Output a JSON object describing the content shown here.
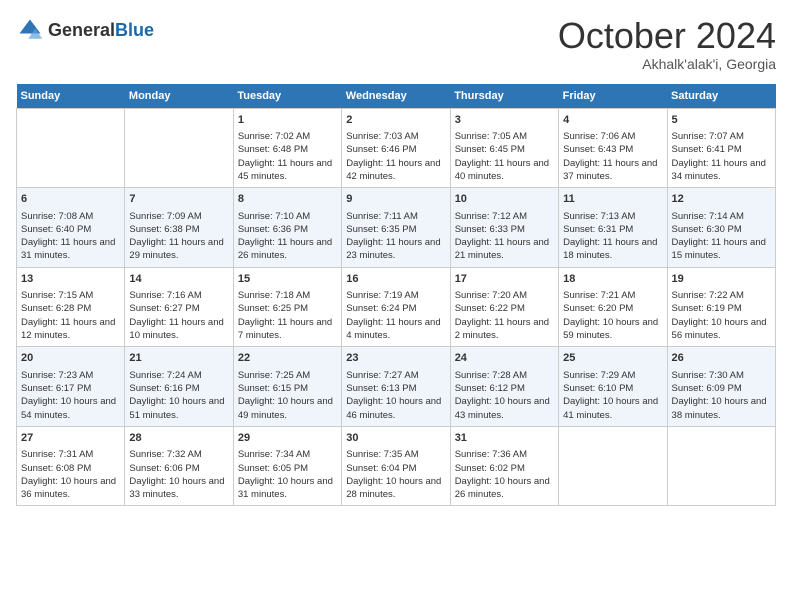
{
  "logo": {
    "general": "General",
    "blue": "Blue"
  },
  "header": {
    "month": "October 2024",
    "location": "Akhalk'alak'i, Georgia"
  },
  "columns": [
    "Sunday",
    "Monday",
    "Tuesday",
    "Wednesday",
    "Thursday",
    "Friday",
    "Saturday"
  ],
  "rows": [
    [
      {
        "day": "",
        "sunrise": "",
        "sunset": "",
        "daylight": ""
      },
      {
        "day": "",
        "sunrise": "",
        "sunset": "",
        "daylight": ""
      },
      {
        "day": "1",
        "sunrise": "Sunrise: 7:02 AM",
        "sunset": "Sunset: 6:48 PM",
        "daylight": "Daylight: 11 hours and 45 minutes."
      },
      {
        "day": "2",
        "sunrise": "Sunrise: 7:03 AM",
        "sunset": "Sunset: 6:46 PM",
        "daylight": "Daylight: 11 hours and 42 minutes."
      },
      {
        "day": "3",
        "sunrise": "Sunrise: 7:05 AM",
        "sunset": "Sunset: 6:45 PM",
        "daylight": "Daylight: 11 hours and 40 minutes."
      },
      {
        "day": "4",
        "sunrise": "Sunrise: 7:06 AM",
        "sunset": "Sunset: 6:43 PM",
        "daylight": "Daylight: 11 hours and 37 minutes."
      },
      {
        "day": "5",
        "sunrise": "Sunrise: 7:07 AM",
        "sunset": "Sunset: 6:41 PM",
        "daylight": "Daylight: 11 hours and 34 minutes."
      }
    ],
    [
      {
        "day": "6",
        "sunrise": "Sunrise: 7:08 AM",
        "sunset": "Sunset: 6:40 PM",
        "daylight": "Daylight: 11 hours and 31 minutes."
      },
      {
        "day": "7",
        "sunrise": "Sunrise: 7:09 AM",
        "sunset": "Sunset: 6:38 PM",
        "daylight": "Daylight: 11 hours and 29 minutes."
      },
      {
        "day": "8",
        "sunrise": "Sunrise: 7:10 AM",
        "sunset": "Sunset: 6:36 PM",
        "daylight": "Daylight: 11 hours and 26 minutes."
      },
      {
        "day": "9",
        "sunrise": "Sunrise: 7:11 AM",
        "sunset": "Sunset: 6:35 PM",
        "daylight": "Daylight: 11 hours and 23 minutes."
      },
      {
        "day": "10",
        "sunrise": "Sunrise: 7:12 AM",
        "sunset": "Sunset: 6:33 PM",
        "daylight": "Daylight: 11 hours and 21 minutes."
      },
      {
        "day": "11",
        "sunrise": "Sunrise: 7:13 AM",
        "sunset": "Sunset: 6:31 PM",
        "daylight": "Daylight: 11 hours and 18 minutes."
      },
      {
        "day": "12",
        "sunrise": "Sunrise: 7:14 AM",
        "sunset": "Sunset: 6:30 PM",
        "daylight": "Daylight: 11 hours and 15 minutes."
      }
    ],
    [
      {
        "day": "13",
        "sunrise": "Sunrise: 7:15 AM",
        "sunset": "Sunset: 6:28 PM",
        "daylight": "Daylight: 11 hours and 12 minutes."
      },
      {
        "day": "14",
        "sunrise": "Sunrise: 7:16 AM",
        "sunset": "Sunset: 6:27 PM",
        "daylight": "Daylight: 11 hours and 10 minutes."
      },
      {
        "day": "15",
        "sunrise": "Sunrise: 7:18 AM",
        "sunset": "Sunset: 6:25 PM",
        "daylight": "Daylight: 11 hours and 7 minutes."
      },
      {
        "day": "16",
        "sunrise": "Sunrise: 7:19 AM",
        "sunset": "Sunset: 6:24 PM",
        "daylight": "Daylight: 11 hours and 4 minutes."
      },
      {
        "day": "17",
        "sunrise": "Sunrise: 7:20 AM",
        "sunset": "Sunset: 6:22 PM",
        "daylight": "Daylight: 11 hours and 2 minutes."
      },
      {
        "day": "18",
        "sunrise": "Sunrise: 7:21 AM",
        "sunset": "Sunset: 6:20 PM",
        "daylight": "Daylight: 10 hours and 59 minutes."
      },
      {
        "day": "19",
        "sunrise": "Sunrise: 7:22 AM",
        "sunset": "Sunset: 6:19 PM",
        "daylight": "Daylight: 10 hours and 56 minutes."
      }
    ],
    [
      {
        "day": "20",
        "sunrise": "Sunrise: 7:23 AM",
        "sunset": "Sunset: 6:17 PM",
        "daylight": "Daylight: 10 hours and 54 minutes."
      },
      {
        "day": "21",
        "sunrise": "Sunrise: 7:24 AM",
        "sunset": "Sunset: 6:16 PM",
        "daylight": "Daylight: 10 hours and 51 minutes."
      },
      {
        "day": "22",
        "sunrise": "Sunrise: 7:25 AM",
        "sunset": "Sunset: 6:15 PM",
        "daylight": "Daylight: 10 hours and 49 minutes."
      },
      {
        "day": "23",
        "sunrise": "Sunrise: 7:27 AM",
        "sunset": "Sunset: 6:13 PM",
        "daylight": "Daylight: 10 hours and 46 minutes."
      },
      {
        "day": "24",
        "sunrise": "Sunrise: 7:28 AM",
        "sunset": "Sunset: 6:12 PM",
        "daylight": "Daylight: 10 hours and 43 minutes."
      },
      {
        "day": "25",
        "sunrise": "Sunrise: 7:29 AM",
        "sunset": "Sunset: 6:10 PM",
        "daylight": "Daylight: 10 hours and 41 minutes."
      },
      {
        "day": "26",
        "sunrise": "Sunrise: 7:30 AM",
        "sunset": "Sunset: 6:09 PM",
        "daylight": "Daylight: 10 hours and 38 minutes."
      }
    ],
    [
      {
        "day": "27",
        "sunrise": "Sunrise: 7:31 AM",
        "sunset": "Sunset: 6:08 PM",
        "daylight": "Daylight: 10 hours and 36 minutes."
      },
      {
        "day": "28",
        "sunrise": "Sunrise: 7:32 AM",
        "sunset": "Sunset: 6:06 PM",
        "daylight": "Daylight: 10 hours and 33 minutes."
      },
      {
        "day": "29",
        "sunrise": "Sunrise: 7:34 AM",
        "sunset": "Sunset: 6:05 PM",
        "daylight": "Daylight: 10 hours and 31 minutes."
      },
      {
        "day": "30",
        "sunrise": "Sunrise: 7:35 AM",
        "sunset": "Sunset: 6:04 PM",
        "daylight": "Daylight: 10 hours and 28 minutes."
      },
      {
        "day": "31",
        "sunrise": "Sunrise: 7:36 AM",
        "sunset": "Sunset: 6:02 PM",
        "daylight": "Daylight: 10 hours and 26 minutes."
      },
      {
        "day": "",
        "sunrise": "",
        "sunset": "",
        "daylight": ""
      },
      {
        "day": "",
        "sunrise": "",
        "sunset": "",
        "daylight": ""
      }
    ]
  ]
}
